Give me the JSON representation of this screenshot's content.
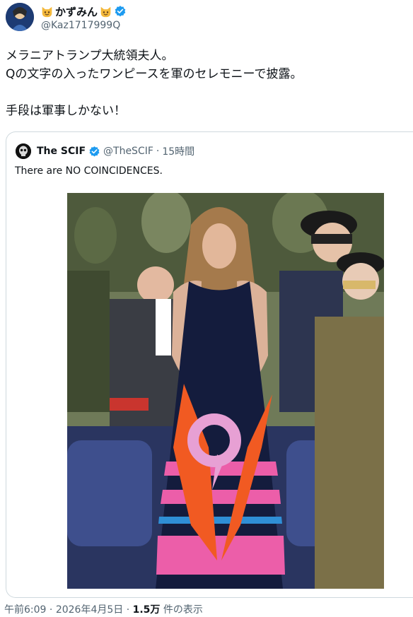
{
  "author": {
    "display_name": "かずみん",
    "handle": "@Kaz1717999Q",
    "verified": true
  },
  "tweet": {
    "lines": [
      "メラニアトランプ大統領夫人。",
      "Qの文字の入ったワンピースを軍のセレモニーで披露。",
      "",
      "手段は軍事しかない！"
    ]
  },
  "quote": {
    "display_name": "The SCIF",
    "handle": "@TheSCIF",
    "separator": "·",
    "time": "15時間",
    "text": "There are NO COINCIDENCES."
  },
  "footer": {
    "time": "午前6:09",
    "separator": "·",
    "date": "2026年4月5日",
    "separator2": "·",
    "views": "1.5万",
    "views_label": "件の表示"
  },
  "colors": {
    "verified_blue": "#1d9bf0",
    "text_secondary": "#536471",
    "border": "#cfd9de"
  },
  "icons": {
    "name_emoji": "cat-face-emoji",
    "verified": "verified-badge-icon"
  }
}
